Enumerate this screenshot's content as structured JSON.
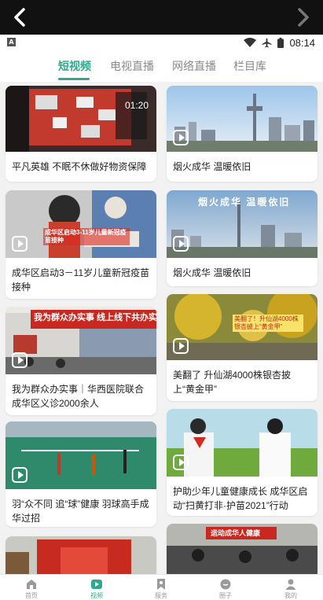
{
  "status": {
    "time": "08:14"
  },
  "tabs": [
    {
      "label": "短视频",
      "active": true
    },
    {
      "label": "电视直播"
    },
    {
      "label": "网络直播"
    },
    {
      "label": "栏目库"
    }
  ],
  "videos": [
    {
      "title": "平凡英雄 不眠不休做好物资保障",
      "duration": "01:20"
    },
    {
      "title": "烟火成华 温暖依旧"
    },
    {
      "title": "成华区启动3－11岁儿童新冠疫苗接种",
      "thumb_text": "成华区启动3-11岁儿童新冠疫苗接种"
    },
    {
      "title": "烟火成华 温暖依旧",
      "thumb_text": "烟火成华 温暖依旧"
    },
    {
      "title": "我为群众办实事｜华西医院联合成华区义诊2000余人",
      "thumb_text": "我为群众办实事 线上线下共办实事"
    },
    {
      "title": "美翻了 升仙湖4000株银杏披上“黄金甲”",
      "thumb_text": "美翻了！升仙湖4000株银杏披上“黄金甲”"
    },
    {
      "title": "羽“众不同 追“球”健康 羽球高手成华过招"
    },
    {
      "title": "护助少年儿童健康成长 成华区启动“扫黄打非·护苗2021”行动"
    },
    {
      "title": ""
    },
    {
      "title": "",
      "thumb_text": "运动成华人健康"
    }
  ],
  "bottom_nav": [
    {
      "label": "首页",
      "icon": "home-icon"
    },
    {
      "label": "视频",
      "icon": "video-icon",
      "active": true
    },
    {
      "label": "服务",
      "icon": "bookmark-icon"
    },
    {
      "label": "圈子",
      "icon": "chat-icon"
    },
    {
      "label": "我的",
      "icon": "user-icon"
    }
  ],
  "colors": {
    "accent": "#2fa98c",
    "top_bar": "#111111",
    "background": "#f2f2f2"
  }
}
